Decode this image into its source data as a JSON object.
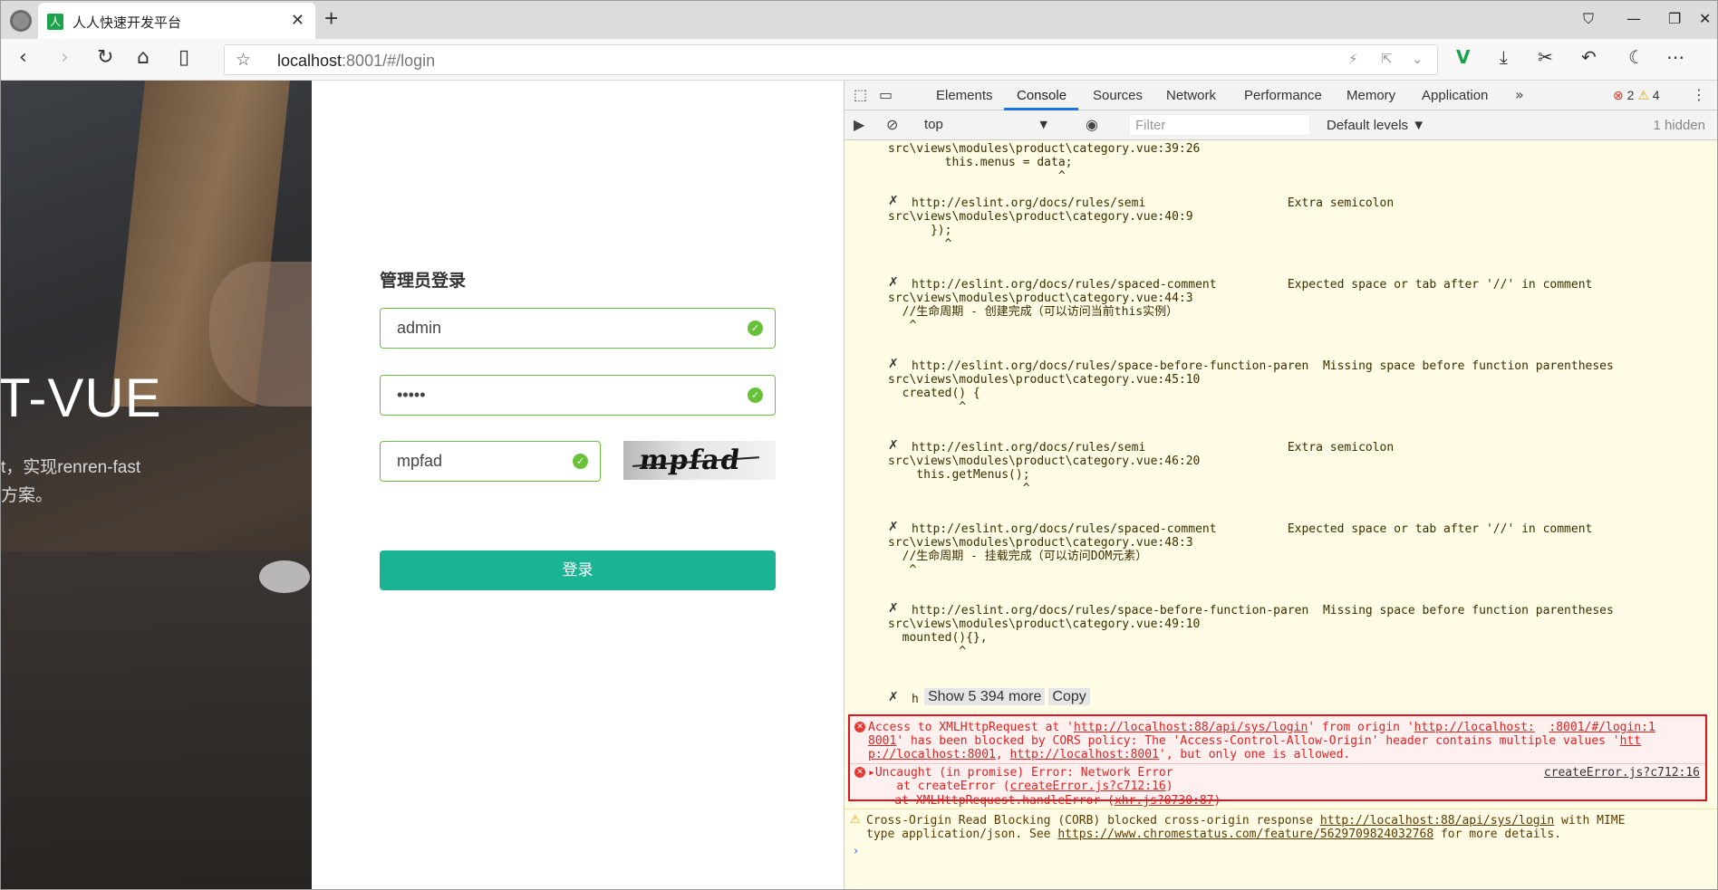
{
  "tab": {
    "title": "人人快速开发平台",
    "favicon": "人"
  },
  "address": {
    "host": "localhost",
    "rest": ":8001/#/login"
  },
  "page": {
    "hero_title": "T-VUE",
    "hero_line1": "t，实现renren-fast",
    "hero_line2": "方案。",
    "login_title": "管理员登录",
    "username": "admin",
    "password": "•••••",
    "captcha_input": "mpfad",
    "captcha_text": "mpfad",
    "login_button": "登录"
  },
  "devtools": {
    "tabs": [
      "Elements",
      "Console",
      "Sources",
      "Network",
      "Performance",
      "Memory",
      "Application"
    ],
    "error_count": "2",
    "warn_count": "4",
    "context": "top",
    "filter_placeholder": "Filter",
    "levels": "Default levels ▼",
    "hidden": "1 hidden",
    "lines": [
      "src\\views\\modules\\product\\category.vue:39:26",
      "        this.menus = data;",
      "                        ^",
      "http://eslint.org/docs/rules/semi                    Extra semicolon",
      "src\\views\\modules\\product\\category.vue:40:9",
      "      });",
      "        ^",
      "http://eslint.org/docs/rules/spaced-comment          Expected space or tab after '//' in comment",
      "src\\views\\modules\\product\\category.vue:44:3",
      "  //生命周期 - 创建完成（可以访问当前this实例）",
      "   ^",
      "http://eslint.org/docs/rules/space-before-function-paren  Missing space before function parentheses",
      "src\\views\\modules\\product\\category.vue:45:10",
      "  created() {",
      "          ^",
      "http://eslint.org/docs/rules/semi                    Extra semicolon",
      "src\\views\\modules\\product\\category.vue:46:20",
      "    this.getMenus();",
      "                   ^",
      "http://eslint.org/docs/rules/spaced-comment          Expected space or tab after '//' in comment",
      "src\\views\\modules\\product\\category.vue:48:3",
      "  //生命周期 - 挂载完成（可以访问DOM元素）",
      "   ^",
      "http://eslint.org/docs/rules/space-before-function-paren  Missing space before function parentheses",
      "src\\views\\modules\\product\\category.vue:49:10",
      "  mounted(){},",
      "          ^"
    ],
    "show_more": "Show 5 394 more",
    "copy": "Copy",
    "h_char": "h",
    "cors_error": {
      "l1a": "Access to XMLHttpRequest at '",
      "l1url": "http://localhost:88/api/sys/login",
      "l1b": "' from origin '",
      "l1origin": "http://localhost:",
      "l1c": "8001",
      "l1link": ":8001/#/login:1",
      "l2": "' has been blocked by CORS policy: The 'Access-Control-Allow-Origin' header contains multiple values '",
      "l2url": "htt",
      "l3url": "p://localhost:8001",
      "l3sep": ", ",
      "l3url2": "http://localhost:8001",
      "l3b": "', but only one is allowed."
    },
    "uncaught": {
      "l1": "Uncaught (in promise) Error: Network Error",
      "link": "createError.js?c712:16",
      "l2a": "    at createError (",
      "l2link": "createError.js?c712:16",
      "l3a": "    at XMLHttpRequest.handleError (",
      "l3link": "xhr.js?0730:87",
      "close": ")"
    },
    "warning": {
      "l1a": "Cross-Origin Read Blocking (CORB) blocked cross-origin response ",
      "l1url": "http://localhost:88/api/sys/login",
      "l1b": " with MIME",
      "l2a": "type application/json. See ",
      "l2url": "https://www.chromestatus.com/feature/5629709824032768",
      "l2b": " for more details."
    }
  }
}
